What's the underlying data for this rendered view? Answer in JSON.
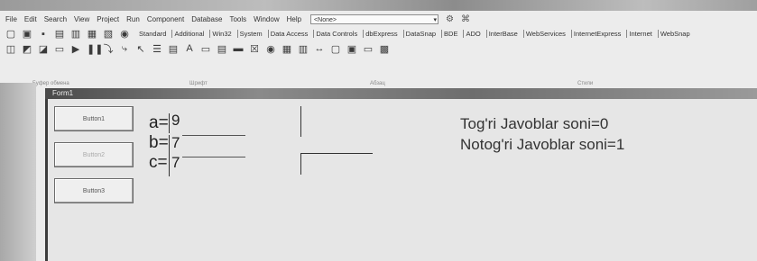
{
  "menu": [
    "File",
    "Edit",
    "Search",
    "View",
    "Project",
    "Run",
    "Component",
    "Database",
    "Tools",
    "Window",
    "Help"
  ],
  "combo": "<None>",
  "palette_tabs": [
    "Standard",
    "Additional",
    "Win32",
    "System",
    "Data Access",
    "Data Controls",
    "dbExpress",
    "DataSnap",
    "BDE",
    "ADO",
    "InterBase",
    "WebServices",
    "InternetExpress",
    "Internet",
    "WebSnap"
  ],
  "ruler_labels": [
    "Буфер обмена",
    "Шрифт",
    "Абзац",
    "Стили"
  ],
  "form_caption": "Form1",
  "buttons": [
    "Button1",
    "Button2",
    "Button3"
  ],
  "inputs": [
    {
      "label": "a=",
      "value": "9"
    },
    {
      "label": "b=",
      "value": "7"
    },
    {
      "label": "c=",
      "value": "7"
    }
  ],
  "status": {
    "correct": "Tog'ri Javoblar soni=0",
    "wrong": "Notog'ri Javoblar soni=1"
  }
}
